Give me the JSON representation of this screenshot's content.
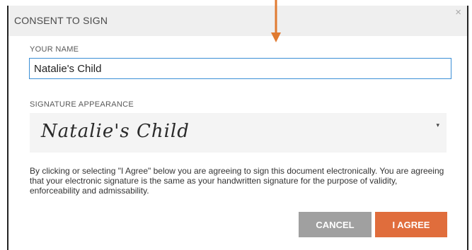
{
  "dialog": {
    "title": "CONSENT TO SIGN",
    "close_icon": "close-icon",
    "close_glyph": "×"
  },
  "name_field": {
    "label": "YOUR NAME",
    "value": "Natalie's Child"
  },
  "signature": {
    "label": "SIGNATURE APPEARANCE",
    "preview": "Natalie's Child",
    "caret": "▾",
    "caret_icon": "chevron-down-icon"
  },
  "disclaimer": "By clicking or selecting \"I Agree\" below you are agreeing to sign this document electronically. You are agreeing that your electronic signature is the same as your handwritten signature for the purpose of validity, enforceability and admissability.",
  "buttons": {
    "cancel": "CANCEL",
    "agree": "I AGREE"
  },
  "colors": {
    "accent": "#e06d3c",
    "input_border": "#3b8fd6",
    "cancel": "#a0a0a0",
    "arrow": "#e07a30"
  }
}
